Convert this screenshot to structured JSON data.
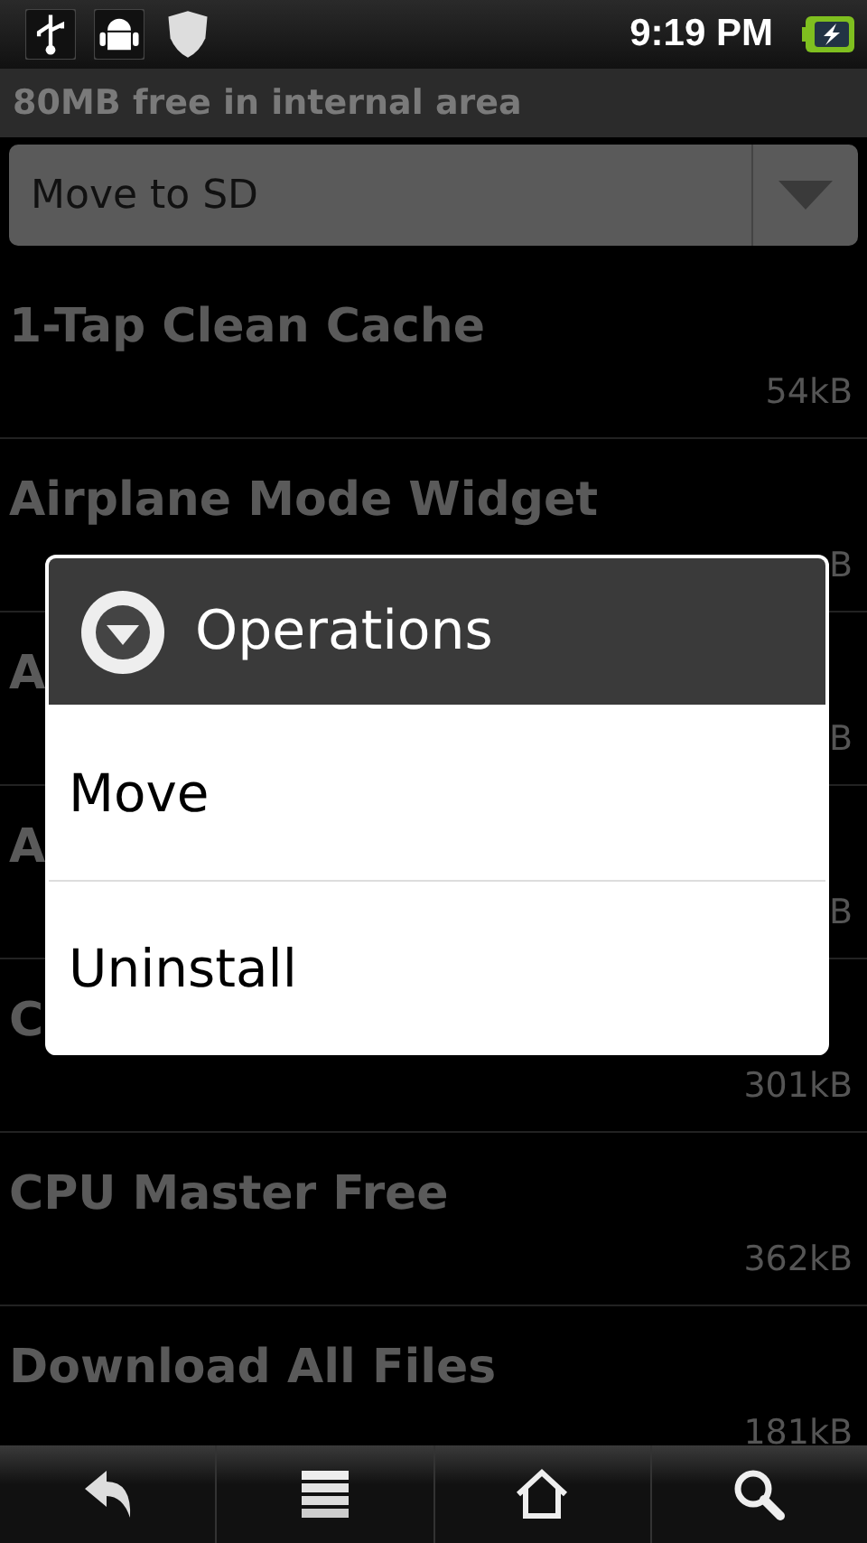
{
  "status_bar": {
    "time": "9:19 PM"
  },
  "storage_info": "80MB free in internal area",
  "mode_dropdown": {
    "value": "Move to SD"
  },
  "apps": [
    {
      "name": "1-Tap Clean Cache",
      "size": "54kB"
    },
    {
      "name": "Airplane Mode Widget",
      "size": "B"
    },
    {
      "name": "A",
      "size": "B"
    },
    {
      "name": "A",
      "size": "B"
    },
    {
      "name": "C",
      "size": "301kB"
    },
    {
      "name": "CPU Master Free",
      "size": "362kB"
    },
    {
      "name": "Download All Files",
      "size": "181kB"
    }
  ],
  "dialog": {
    "title": "Operations",
    "options": [
      "Move",
      "Uninstall"
    ]
  },
  "nav_bar": [
    {
      "kind": "back"
    },
    {
      "kind": "menu"
    },
    {
      "kind": "home"
    },
    {
      "kind": "search"
    }
  ]
}
